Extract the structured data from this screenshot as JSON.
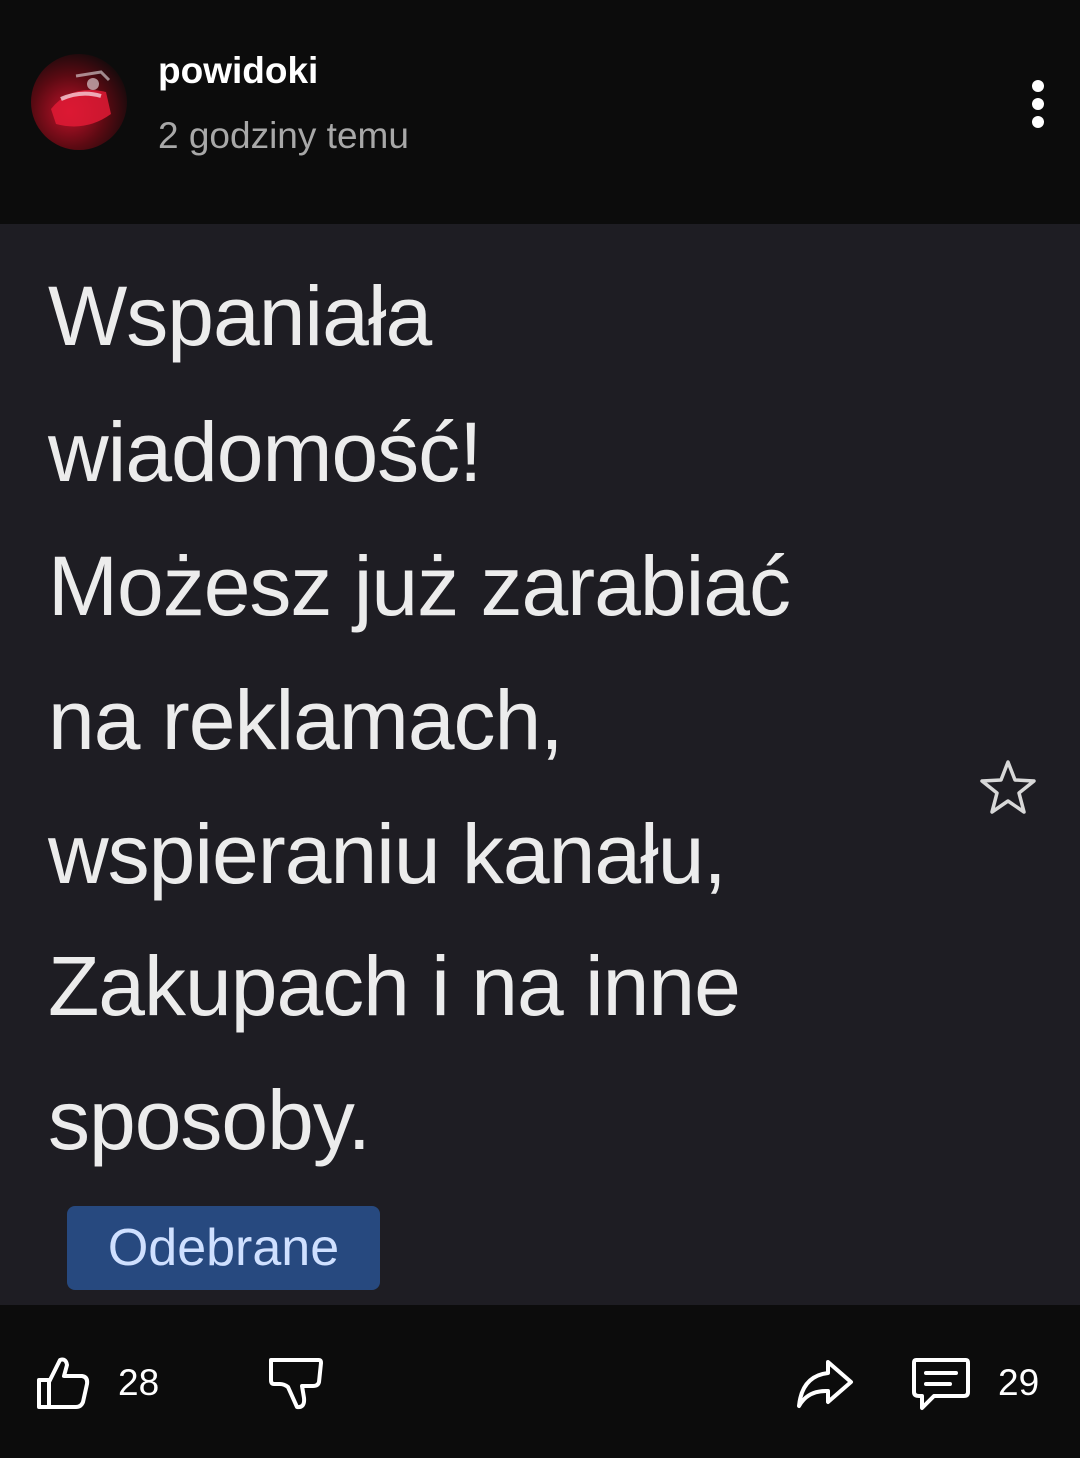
{
  "post": {
    "author": "powidoki",
    "timestamp": "2 godziny temu"
  },
  "image": {
    "lines": [
      "Wspaniała",
      "wiadomość!",
      "Możesz już zarabiać",
      "na reklamach,",
      "wspieraniu kanału,",
      "Zakupach i na inne",
      "sposoby."
    ],
    "badge": "Odebrane"
  },
  "actions": {
    "like_count": "28",
    "comment_count": "29"
  },
  "icons": {
    "menu": "more-vertical-icon",
    "star": "star-icon",
    "like": "thumbs-up-icon",
    "dislike": "thumbs-down-icon",
    "share": "share-icon",
    "comments": "comment-icon"
  },
  "colors": {
    "background": "#0c0c0c",
    "image_background": "#1e1d23",
    "badge": "#27497f",
    "badge_text": "#cfe0ff",
    "secondary_text": "#a8a8a8"
  }
}
